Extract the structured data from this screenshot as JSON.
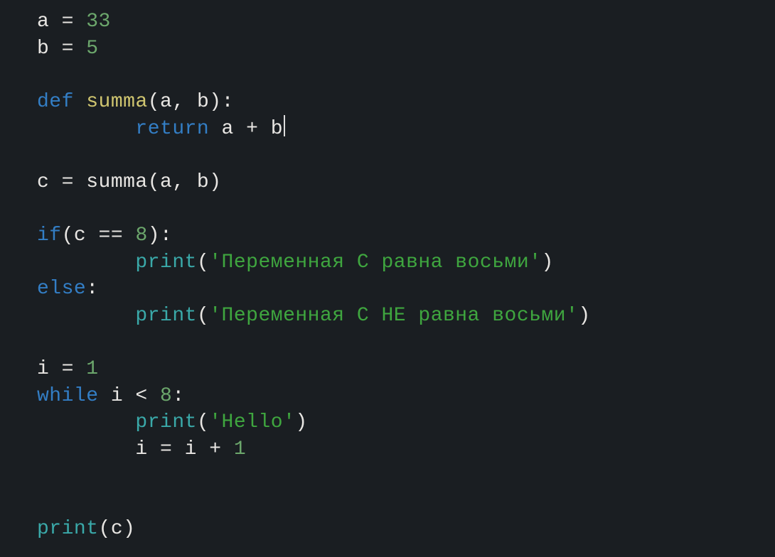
{
  "code": {
    "lines": [
      {
        "tokens": [
          {
            "cls": "tok-default",
            "text": "a = "
          },
          {
            "cls": "tok-number",
            "text": "33"
          }
        ]
      },
      {
        "tokens": [
          {
            "cls": "tok-default",
            "text": "b = "
          },
          {
            "cls": "tok-number",
            "text": "5"
          }
        ]
      },
      {
        "tokens": []
      },
      {
        "tokens": [
          {
            "cls": "tok-keyword",
            "text": "def"
          },
          {
            "cls": "tok-default",
            "text": " "
          },
          {
            "cls": "tok-funcname",
            "text": "summa"
          },
          {
            "cls": "tok-default",
            "text": "(a, b):"
          }
        ]
      },
      {
        "tokens": [
          {
            "cls": "tok-default",
            "text": "        "
          },
          {
            "cls": "tok-keyword",
            "text": "return"
          },
          {
            "cls": "tok-default",
            "text": " a + b"
          }
        ],
        "cursor_after": true
      },
      {
        "tokens": []
      },
      {
        "tokens": [
          {
            "cls": "tok-default",
            "text": "c = summa(a, b)"
          }
        ]
      },
      {
        "tokens": []
      },
      {
        "tokens": [
          {
            "cls": "tok-keyword",
            "text": "if"
          },
          {
            "cls": "tok-default",
            "text": "(c == "
          },
          {
            "cls": "tok-number",
            "text": "8"
          },
          {
            "cls": "tok-default",
            "text": "):"
          }
        ]
      },
      {
        "tokens": [
          {
            "cls": "tok-default",
            "text": "        "
          },
          {
            "cls": "tok-builtin",
            "text": "print"
          },
          {
            "cls": "tok-default",
            "text": "("
          },
          {
            "cls": "tok-string",
            "text": "'Переменная С равна восьми'"
          },
          {
            "cls": "tok-default",
            "text": ")"
          }
        ]
      },
      {
        "tokens": [
          {
            "cls": "tok-keyword",
            "text": "else"
          },
          {
            "cls": "tok-default",
            "text": ":"
          }
        ]
      },
      {
        "tokens": [
          {
            "cls": "tok-default",
            "text": "        "
          },
          {
            "cls": "tok-builtin",
            "text": "print"
          },
          {
            "cls": "tok-default",
            "text": "("
          },
          {
            "cls": "tok-string",
            "text": "'Переменная С НЕ равна восьми'"
          },
          {
            "cls": "tok-default",
            "text": ")"
          }
        ]
      },
      {
        "tokens": []
      },
      {
        "tokens": [
          {
            "cls": "tok-default",
            "text": "i = "
          },
          {
            "cls": "tok-number",
            "text": "1"
          }
        ]
      },
      {
        "tokens": [
          {
            "cls": "tok-keyword",
            "text": "while"
          },
          {
            "cls": "tok-default",
            "text": " i < "
          },
          {
            "cls": "tok-number",
            "text": "8"
          },
          {
            "cls": "tok-default",
            "text": ":"
          }
        ]
      },
      {
        "tokens": [
          {
            "cls": "tok-default",
            "text": "        "
          },
          {
            "cls": "tok-builtin",
            "text": "print"
          },
          {
            "cls": "tok-default",
            "text": "("
          },
          {
            "cls": "tok-string",
            "text": "'Hello'"
          },
          {
            "cls": "tok-default",
            "text": ")"
          }
        ]
      },
      {
        "tokens": [
          {
            "cls": "tok-default",
            "text": "        i = i + "
          },
          {
            "cls": "tok-number",
            "text": "1"
          }
        ]
      },
      {
        "tokens": []
      },
      {
        "tokens": []
      },
      {
        "tokens": [
          {
            "cls": "tok-builtin",
            "text": "print"
          },
          {
            "cls": "tok-default",
            "text": "(c)"
          }
        ]
      }
    ]
  }
}
